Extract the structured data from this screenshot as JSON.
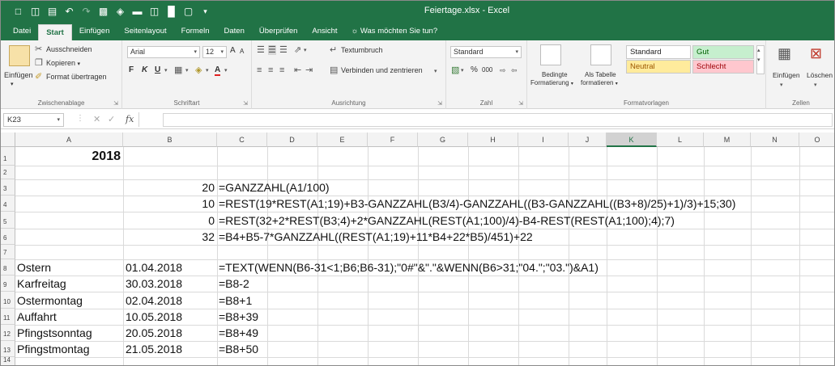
{
  "window": {
    "title": "Feiertage.xlsx - Excel"
  },
  "qat": {
    "new_icon": "new-document-icon",
    "open_icon": "open-folder-icon",
    "save_icon": "save-icon",
    "undo_icon": "undo-icon",
    "redo_icon": "redo-icon"
  },
  "tabs": [
    "Datei",
    "Start",
    "Einfügen",
    "Seitenlayout",
    "Formeln",
    "Daten",
    "Überprüfen",
    "Ansicht"
  ],
  "tell_me": "Was möchten Sie tun?",
  "ribbon": {
    "clipboard": {
      "paste": "Einfügen",
      "cut": "Ausschneiden",
      "copy": "Kopieren",
      "format_painter": "Format übertragen",
      "label": "Zwischenablage"
    },
    "font": {
      "name": "Arial",
      "size": "12",
      "bold": "F",
      "italic": "K",
      "underline": "U",
      "grow": "A",
      "shrink": "A",
      "label": "Schriftart"
    },
    "alignment": {
      "wrap": "Textumbruch",
      "merge": "Verbinden und zentrieren",
      "label": "Ausrichtung"
    },
    "number": {
      "format": "Standard",
      "percent": "%",
      "thousands": "000",
      "label": "Zahl"
    },
    "styles": {
      "conditional": "Bedingte",
      "conditional2": "Formatierung",
      "as_table": "Als Tabelle",
      "as_table2": "formatieren",
      "standard": "Standard",
      "gut": "Gut",
      "neutral": "Neutral",
      "schlecht": "Schlecht",
      "label": "Formatvorlagen"
    },
    "cells": {
      "insert": "Einfügen",
      "delete": "Löschen",
      "label": "Zellen"
    }
  },
  "formula_bar": {
    "name_box": "K23",
    "fx": "fx",
    "content": ""
  },
  "columns": [
    "A",
    "B",
    "C",
    "D",
    "E",
    "F",
    "G",
    "H",
    "I",
    "J",
    "K",
    "L",
    "M",
    "N",
    "O"
  ],
  "selected_column": "K",
  "rows": [
    "1",
    "2",
    "3",
    "4",
    "5",
    "6",
    "7",
    "8",
    "9",
    "10",
    "11",
    "12",
    "13",
    "14"
  ],
  "cells": {
    "A1": "2018",
    "B3": "20",
    "C3": "=GANZZAHL(A1/100)",
    "B4": "10",
    "C4": "=REST(19*REST(A1;19)+B3-GANZZAHL(B3/4)-GANZZAHL((B3-GANZZAHL((B3+8)/25)+1)/3)+15;30)",
    "B5": "0",
    "C5": "=REST(32+2*REST(B3;4)+2*GANZZAHL(REST(A1;100)/4)-B4-REST(REST(A1;100);4);7)",
    "B6": "32",
    "C6": "=B4+B5-7*GANZZAHL((REST(A1;19)+11*B4+22*B5)/451)+22",
    "A8": "Ostern",
    "B8": "01.04.2018",
    "C8": "=TEXT(WENN(B6-31<1;B6;B6-31);\"0#\"&\".\"&WENN(B6>31;\"04.\";\"03.\")&A1)",
    "A9": "Karfreitag",
    "B9": "30.03.2018",
    "C9": "=B8-2",
    "A10": "Ostermontag",
    "B10": "02.04.2018",
    "C10": "=B8+1",
    "A11": "Auffahrt",
    "B11": "10.05.2018",
    "C11": "=B8+39",
    "A12": "Pfingstsonntag",
    "B12": "20.05.2018",
    "C12": "=B8+49",
    "A13": "Pfingstmontag",
    "B13": "21.05.2018",
    "C13": "=B8+50"
  },
  "colors": {
    "excel_green": "#217346",
    "gut_fill": "#c6efce",
    "gut_text": "#006100",
    "neutral_fill": "#ffeb9c",
    "neutral_text": "#9c5700",
    "schlecht_fill": "#ffc7ce",
    "schlecht_text": "#9c0006"
  }
}
